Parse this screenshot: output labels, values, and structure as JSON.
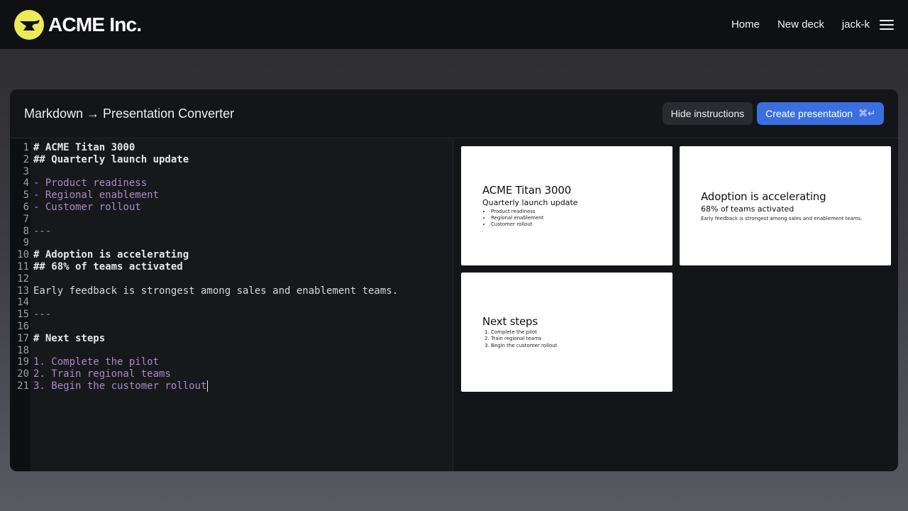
{
  "header": {
    "brand": "ACME Inc.",
    "logo_icon": "anvil-icon",
    "nav": {
      "home": "Home",
      "new_deck": "New deck",
      "user": "jack-k"
    },
    "menu_icon": "hamburger-menu-icon"
  },
  "converter": {
    "title": "Markdown → Presentation Converter",
    "hide_instructions": "Hide instructions",
    "create_presentation": "Create presentation",
    "create_shortcut": "⌘↵"
  },
  "editor": {
    "lines": [
      {
        "n": "1",
        "text": "# ACME Titan 3000",
        "kind": "head"
      },
      {
        "n": "2",
        "text": "## Quarterly launch update",
        "kind": "head"
      },
      {
        "n": "3",
        "text": "",
        "kind": "text"
      },
      {
        "n": "4",
        "text": "- Product readiness",
        "kind": "list"
      },
      {
        "n": "5",
        "text": "- Regional enablement",
        "kind": "list"
      },
      {
        "n": "6",
        "text": "- Customer rollout",
        "kind": "list"
      },
      {
        "n": "7",
        "text": "",
        "kind": "text"
      },
      {
        "n": "8",
        "text": "---",
        "kind": "sep"
      },
      {
        "n": "9",
        "text": "",
        "kind": "text"
      },
      {
        "n": "10",
        "text": "# Adoption is accelerating",
        "kind": "head"
      },
      {
        "n": "11",
        "text": "## 68% of teams activated",
        "kind": "head"
      },
      {
        "n": "12",
        "text": "",
        "kind": "text"
      },
      {
        "n": "13",
        "text": "Early feedback is strongest among sales and enablement teams.",
        "kind": "text"
      },
      {
        "n": "14",
        "text": "",
        "kind": "text"
      },
      {
        "n": "15",
        "text": "---",
        "kind": "sep"
      },
      {
        "n": "16",
        "text": "",
        "kind": "text"
      },
      {
        "n": "17",
        "text": "# Next steps",
        "kind": "head"
      },
      {
        "n": "18",
        "text": "",
        "kind": "text"
      },
      {
        "n": "19",
        "text": "1. Complete the pilot",
        "kind": "list"
      },
      {
        "n": "20",
        "text": "2. Train regional teams",
        "kind": "list"
      },
      {
        "n": "21",
        "text": "3. Begin the customer rollout",
        "kind": "list"
      }
    ]
  },
  "slides": [
    {
      "title": "ACME Titan 3000",
      "subtitle": "Quarterly launch update",
      "bullets": [
        "Product readiness",
        "Regional enablement",
        "Customer rollout"
      ]
    },
    {
      "title": "Adoption is accelerating",
      "subtitle": "68% of teams activated",
      "paragraph": "Early feedback is strongest among sales and enablement teams."
    },
    {
      "title": "Next steps",
      "numbered": [
        "Complete the pilot",
        "Train regional teams",
        "Begin the customer rollout"
      ]
    }
  ],
  "colors": {
    "primary": "#3b6fe0",
    "logo": "#ecea5a",
    "markdown_list": "#a98bc9"
  }
}
